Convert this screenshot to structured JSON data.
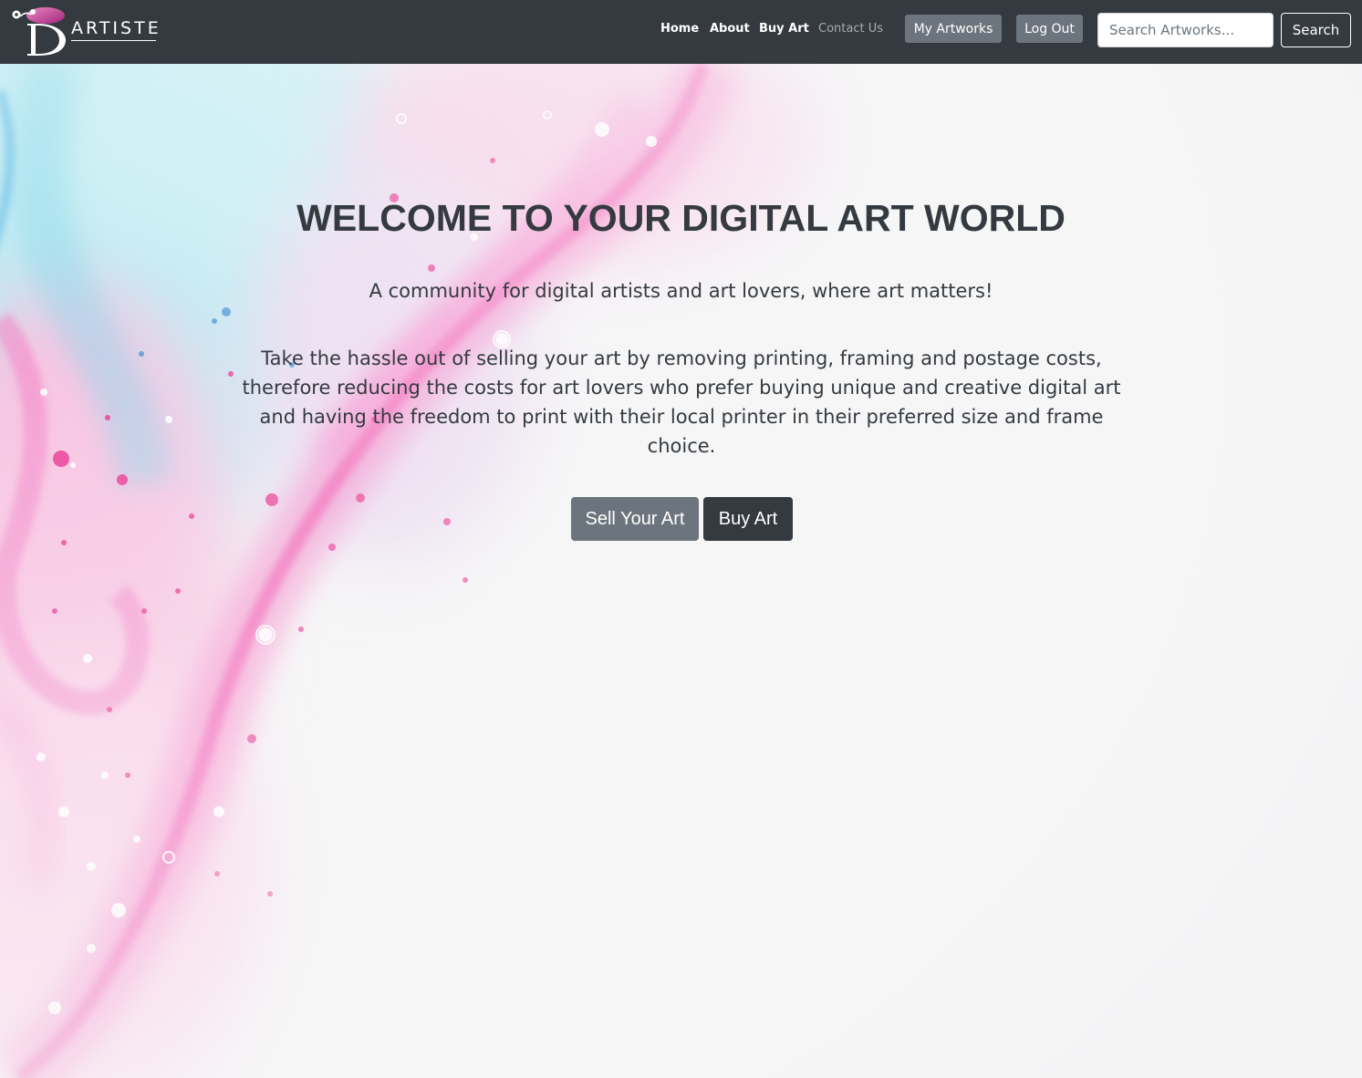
{
  "brand": {
    "wordmark": "ARTISTE",
    "logo_letter": "D",
    "logo_icon": "palette-logo-icon",
    "accent_color": "#c0307e"
  },
  "nav": {
    "links": [
      "Home",
      "About",
      "Buy Art",
      "Contact Us"
    ],
    "my_artworks": "My Artworks",
    "log_out": "Log Out"
  },
  "search": {
    "placeholder": "Search Artworks...",
    "value": "",
    "button": "Search"
  },
  "hero": {
    "title": "WELCOME TO YOUR DIGITAL ART WORLD",
    "tagline": "A community for digital artists and art lovers, where art matters!",
    "description": "Take the hassle out of selling your art by removing printing, framing and postage costs, therefore reducing the costs for art lovers who prefer buying unique and creative digital art and having the freedom to print with their local printer in their preferred size and frame choice.",
    "sell_button": "Sell Your Art",
    "buy_button": "Buy Art"
  },
  "colors": {
    "navbar_bg": "#343a40",
    "secondary_button": "#6c757d",
    "dark_button": "#343a40",
    "splash_pink": "#f06aba",
    "splash_blue": "#a6e2ee"
  }
}
